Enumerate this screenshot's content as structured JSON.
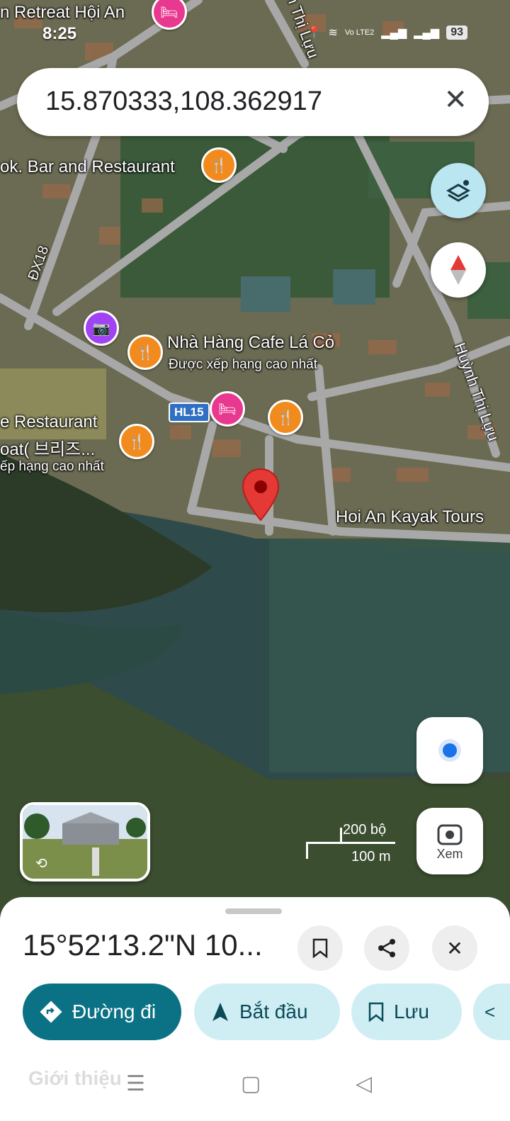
{
  "status_bar": {
    "time": "8:25",
    "network": "Vo LTE2",
    "battery": "93"
  },
  "search": {
    "query": "15.870333,108.362917"
  },
  "map": {
    "labels": {
      "retreat": "n Retreat Hội An",
      "bar_restaurant": "ok. Bar and Restaurant",
      "dx18": "ĐX18",
      "cafe_name": "Nhà Hàng Cafe Lá Cỏ",
      "cafe_rating": "Được xếp hạng cao nhất",
      "hl15": "HL15",
      "left_restaurant": "e Restaurant",
      "left_boat": "oat( 브리즈...",
      "left_rating": "ếp hạng cao nhất",
      "kayak": "Hoi An Kayak Tours",
      "huynh_top": "n Thị Lựu",
      "huynh_right": "Huỳnh Thị Lựu"
    },
    "scale": {
      "feet": "200 bộ",
      "meters": "100 m"
    },
    "xem_label": "Xem"
  },
  "sheet": {
    "coordinates": "15°52'13.2\"N 10...",
    "buttons": {
      "directions": "Đường đi",
      "start": "Bắt đầu",
      "save": "Lưu"
    },
    "about": "Giới thiệu"
  },
  "colors": {
    "accent": "#0b7285",
    "chip_bg": "#cfeef4",
    "food_pin": "#f28b1e",
    "hotel_pin": "#e8388f",
    "marker": "#e53935"
  }
}
